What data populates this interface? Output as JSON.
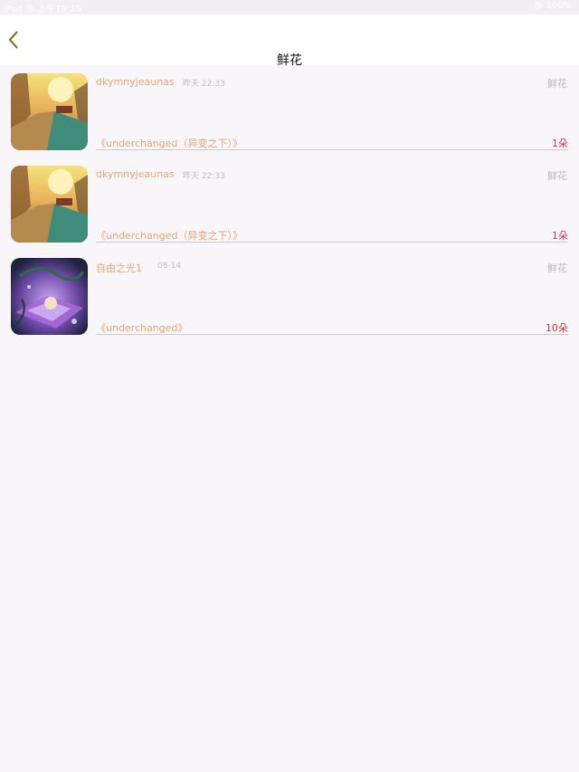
{
  "status_bar": {
    "left_text": "iPad 令 上午10:25",
    "right_text": "@ 100%"
  },
  "nav": {
    "title": "鲜花",
    "back_icon": "chevron-left-icon",
    "accent_color": "#6b6d1a"
  },
  "gifts": [
    {
      "sender": "dkymnyjeaunas",
      "time": "昨天 22:33",
      "type": "鲜花",
      "work": "《underchanged（异变之下）》",
      "count": "1朵",
      "thumb": "sunset-street"
    },
    {
      "sender": "dkymnyjeaunas",
      "time": "昨天 22:33",
      "type": "鲜花",
      "work": "《underchanged（异变之下）》",
      "count": "1朵",
      "thumb": "sunset-street"
    },
    {
      "sender": "自由之光1",
      "time": "08-14",
      "type": "鲜花",
      "work": "《underchanged》",
      "count": "10朵",
      "thumb": "anime-purple"
    }
  ],
  "colors": {
    "name": "#e4a577",
    "count": "#c0394b",
    "muted": "#bdbdbd"
  }
}
